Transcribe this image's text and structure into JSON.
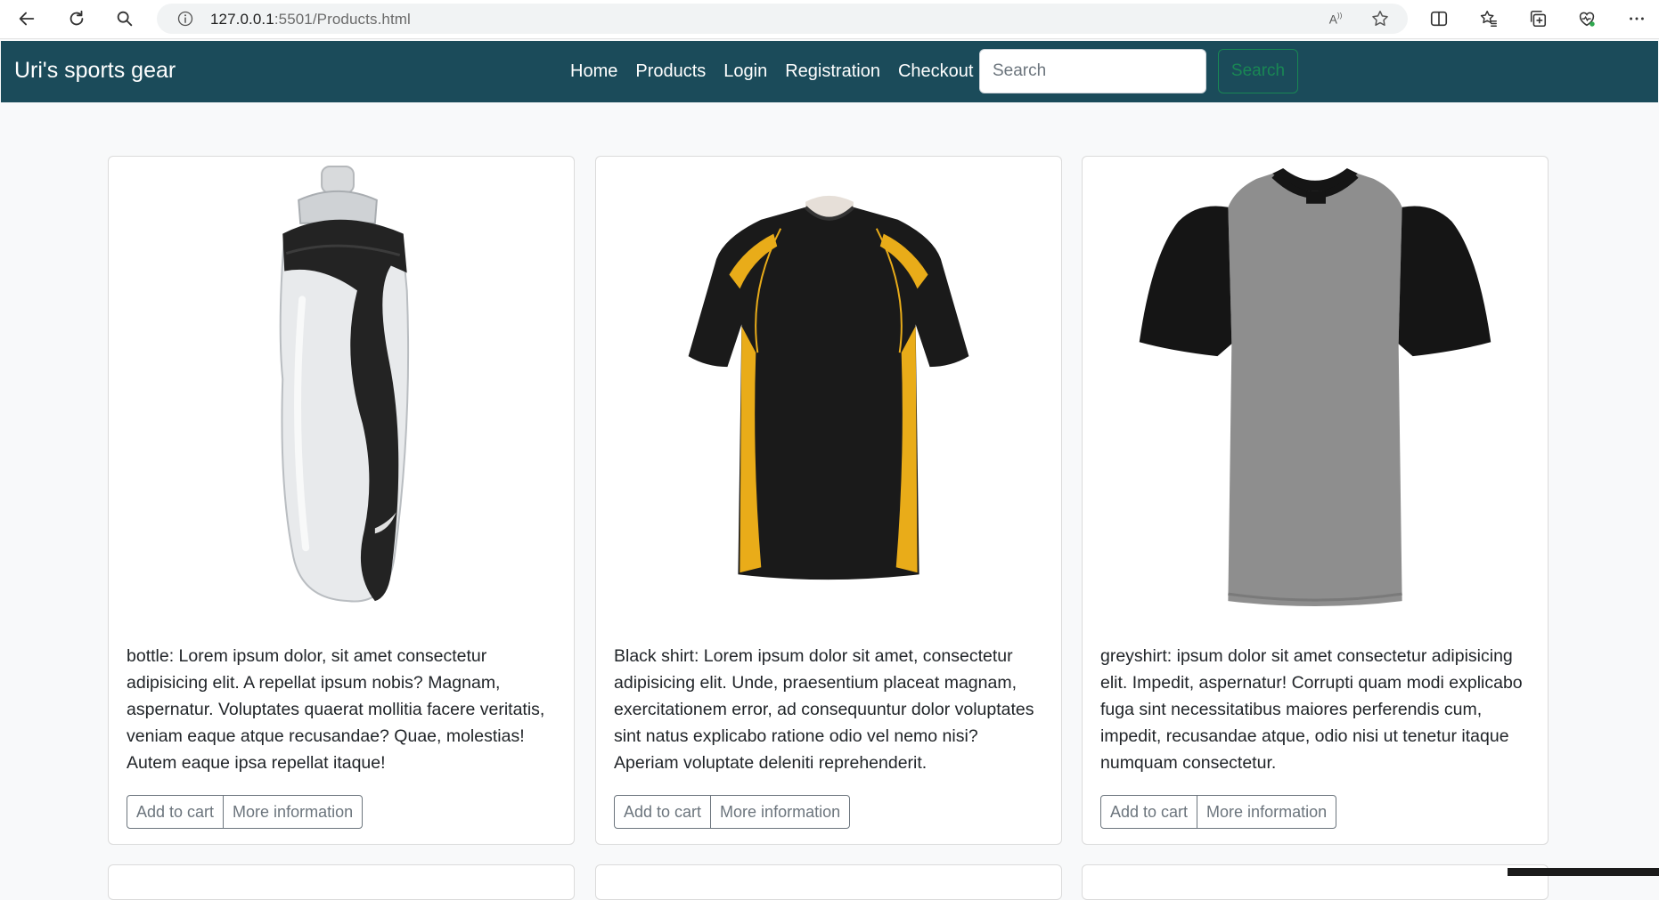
{
  "browser": {
    "url_host": "127.0.0.1",
    "url_rest": ":5501/Products.html",
    "icons": [
      "back-icon",
      "refresh-icon",
      "search-icon",
      "info-icon",
      "read-aloud-icon",
      "favorite-star-icon",
      "split-screen-icon",
      "favorites-icon",
      "collections-icon",
      "browser-essentials-icon",
      "more-icon"
    ]
  },
  "navbar": {
    "brand": "Uri's sports gear",
    "links": [
      "Home",
      "Products",
      "Login",
      "Registration",
      "Checkout"
    ],
    "search_placeholder": "Search",
    "search_button": "Search"
  },
  "products": [
    {
      "image": "water-bottle",
      "description": "bottle: Lorem ipsum dolor, sit amet consectetur adipisicing elit. A repellat ipsum nobis? Magnam, aspernatur. Voluptates quaerat mollitia facere veritatis, veniam eaque atque recusandae? Quae, molestias! Autem eaque ipsa repellat itaque!",
      "add_to_cart": "Add to cart",
      "more_info": "More information"
    },
    {
      "image": "black-yellow-shirt",
      "description": "Black shirt: Lorem ipsum dolor sit amet, consectetur adipisicing elit. Unde, praesentium placeat magnam, exercitationem error, ad consequuntur dolor voluptates sint natus explicabo ratione odio vel nemo nisi? Aperiam voluptate deleniti reprehenderit.",
      "add_to_cart": "Add to cart",
      "more_info": "More information"
    },
    {
      "image": "grey-black-shirt",
      "description": "greyshirt: ipsum dolor sit amet consectetur adipisicing elit. Impedit, aspernatur! Corrupti quam modi explicabo fuga sint necessitatibus maiores perferendis cum, impedit, recusandae atque, odio nisi ut tenetur itaque numquam consectetur.",
      "add_to_cart": "Add to cart",
      "more_info": "More information"
    }
  ],
  "colors": {
    "navbar_bg": "#1b4b5a",
    "page_bg": "#f8f9fa",
    "search_button": "#198754",
    "button_outline": "#6c757d"
  }
}
